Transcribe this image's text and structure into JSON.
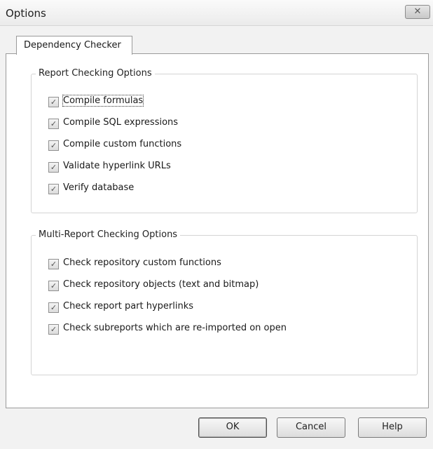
{
  "window": {
    "title": "Options",
    "close_glyph": "✕"
  },
  "tabs": [
    {
      "label": "Dependency Checker"
    }
  ],
  "report_group": {
    "legend": "Report Checking Options",
    "options": [
      {
        "label": "Compile formulas",
        "checked": true
      },
      {
        "label": "Compile SQL expressions",
        "checked": true
      },
      {
        "label": "Compile custom functions",
        "checked": true
      },
      {
        "label": "Validate hyperlink URLs",
        "checked": true
      },
      {
        "label": "Verify database",
        "checked": true
      }
    ]
  },
  "multi_group": {
    "legend": "Multi-Report Checking Options",
    "options": [
      {
        "label": "Check repository custom functions",
        "checked": true
      },
      {
        "label": "Check repository objects (text and bitmap)",
        "checked": true
      },
      {
        "label": "Check report part hyperlinks",
        "checked": true
      },
      {
        "label": "Check subreports which are re-imported on open",
        "checked": true
      }
    ]
  },
  "buttons": {
    "ok": "OK",
    "cancel": "Cancel",
    "help": "Help"
  },
  "check_glyph": "✓"
}
